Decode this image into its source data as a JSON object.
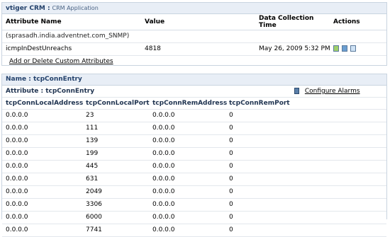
{
  "panel1": {
    "title_bold": "vtiger CRM :",
    "title_sub": "CRM Application",
    "headers": {
      "attribute_name": "Attribute Name",
      "value": "Value",
      "data_collection_time": "Data Collection Time",
      "actions": "Actions"
    },
    "host": "(sprasadh.india.adventnet.com_SNMP)",
    "row": {
      "attribute": "icmpInDestUnreachs",
      "value": "4818",
      "time": "May 26, 2009 5:32 PM",
      "action_icons": [
        "edit-icon",
        "alarm-icon",
        "chart-icon"
      ]
    },
    "add_link": "Add or Delete Custom Attributes"
  },
  "panel2": {
    "title": "Name : tcpConnEntry",
    "attribute_label": "Attribute : tcpConnEntry",
    "configure_alarms": "Configure Alarms",
    "columns": [
      "tcpConnLocalAddress",
      "tcpConnLocalPort",
      "tcpConnRemAddress",
      "tcpConnRemPort"
    ],
    "rows": [
      [
        "0.0.0.0",
        "23",
        "0.0.0.0",
        "0"
      ],
      [
        "0.0.0.0",
        "111",
        "0.0.0.0",
        "0"
      ],
      [
        "0.0.0.0",
        "139",
        "0.0.0.0",
        "0"
      ],
      [
        "0.0.0.0",
        "199",
        "0.0.0.0",
        "0"
      ],
      [
        "0.0.0.0",
        "445",
        "0.0.0.0",
        "0"
      ],
      [
        "0.0.0.0",
        "631",
        "0.0.0.0",
        "0"
      ],
      [
        "0.0.0.0",
        "2049",
        "0.0.0.0",
        "0"
      ],
      [
        "0.0.0.0",
        "3306",
        "0.0.0.0",
        "0"
      ],
      [
        "0.0.0.0",
        "6000",
        "0.0.0.0",
        "0"
      ],
      [
        "0.0.0.0",
        "7741",
        "0.0.0.0",
        "0"
      ]
    ]
  }
}
